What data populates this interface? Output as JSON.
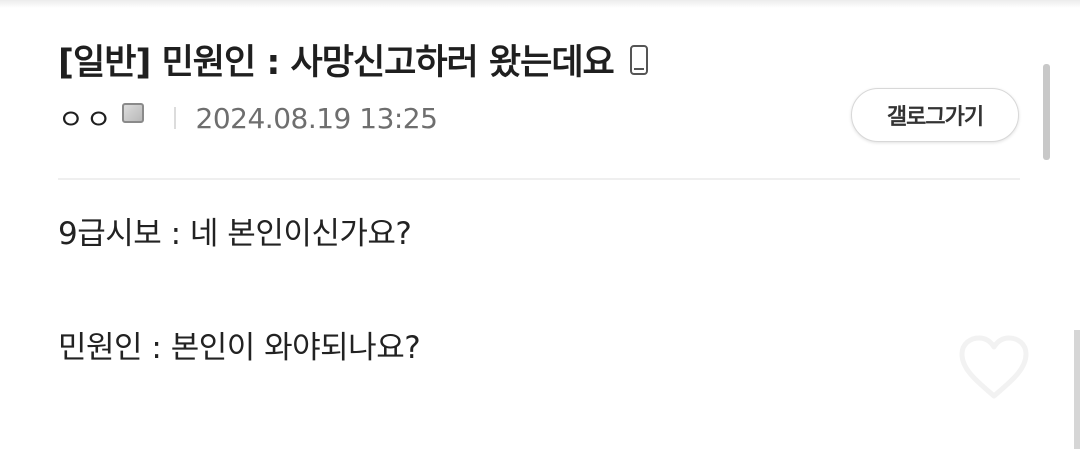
{
  "post": {
    "title": "[일반] 민원인 : 사망신고하러 왔는데요",
    "writer": "ㅇㅇ",
    "date": "2024.08.19 13:25",
    "gallery_button_label": "갤로그가기",
    "body_lines": [
      "9급시보 : 네 본인이신가요?",
      "민원인 : 본인이 와야되나요?"
    ]
  },
  "icons": {
    "title_icon": "mobile-phone-icon",
    "writer_icon": "image-icon",
    "like_icon": "heart-icon"
  },
  "colors": {
    "text": "#1f1f1f",
    "date": "#6e6e6e",
    "button_border": "#d8d8d8"
  }
}
